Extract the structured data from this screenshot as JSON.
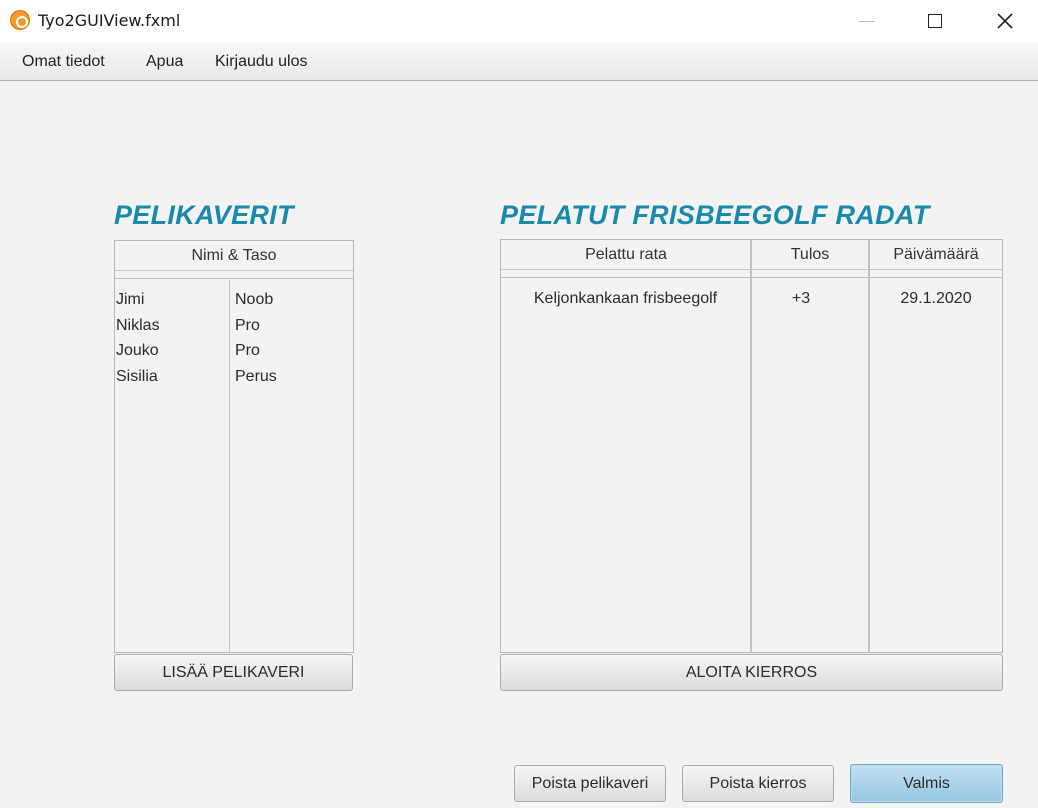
{
  "window": {
    "title": "Tyo2GUIView.fxml",
    "app_icon": "rose-icon",
    "controls": [
      "minimize-icon",
      "maximize-icon",
      "close-icon"
    ]
  },
  "menu": {
    "items": [
      "Omat tiedot",
      "Apua",
      "Kirjaudu ulos"
    ]
  },
  "friends": {
    "heading": "PELIKAVERIT",
    "column_header": "Nimi & Taso",
    "rows": [
      {
        "name": "Jimi",
        "level": "Noob"
      },
      {
        "name": "Niklas",
        "level": "Pro"
      },
      {
        "name": "Jouko",
        "level": "Pro"
      },
      {
        "name": "Sisilia",
        "level": "Perus"
      }
    ],
    "add_button": "LISÄÄ PELIKAVERI"
  },
  "courses": {
    "heading": "PELATUT FRISBEEGOLF RADAT",
    "columns": [
      "Pelattu rata",
      "Tulos",
      "Päivämäärä"
    ],
    "rows": [
      {
        "course": "Keljonkankaan frisbeegolf",
        "result": "+3",
        "date": "29.1.2020"
      }
    ],
    "start_button": "ALOITA KIERROS"
  },
  "footer": {
    "remove_friend": "Poista pelikaveri",
    "remove_round": "Poista kierros",
    "done": "Valmis"
  },
  "colors": {
    "heading": "#1a8aab",
    "primary_button": "#a9d3ea"
  }
}
